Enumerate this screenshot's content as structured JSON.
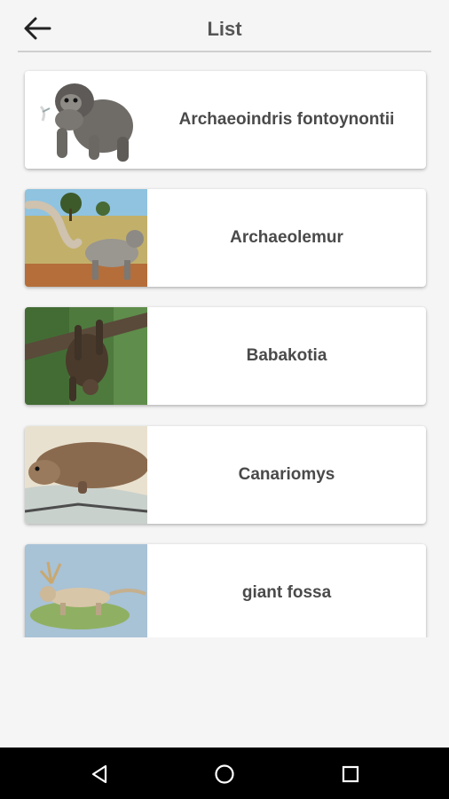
{
  "header": {
    "title": "List",
    "back_icon": "arrow-left-icon"
  },
  "items": [
    {
      "label": "Archaeoindris fontoynontii",
      "image": "archaeoindris-illustration"
    },
    {
      "label": "Archaeolemur",
      "image": "archaeolemur-illustration"
    },
    {
      "label": "Babakotia",
      "image": "babakotia-illustration"
    },
    {
      "label": "Canariomys",
      "image": "canariomys-illustration"
    },
    {
      "label": "giant fossa",
      "image": "giant-fossa-illustration"
    }
  ],
  "navbar": {
    "back_icon": "triangle-back-icon",
    "home_icon": "circle-home-icon",
    "recents_icon": "square-recents-icon"
  },
  "colors": {
    "background": "#f5f5f5",
    "card": "#ffffff",
    "text": "#4a4a4a",
    "navbar": "#000000"
  }
}
